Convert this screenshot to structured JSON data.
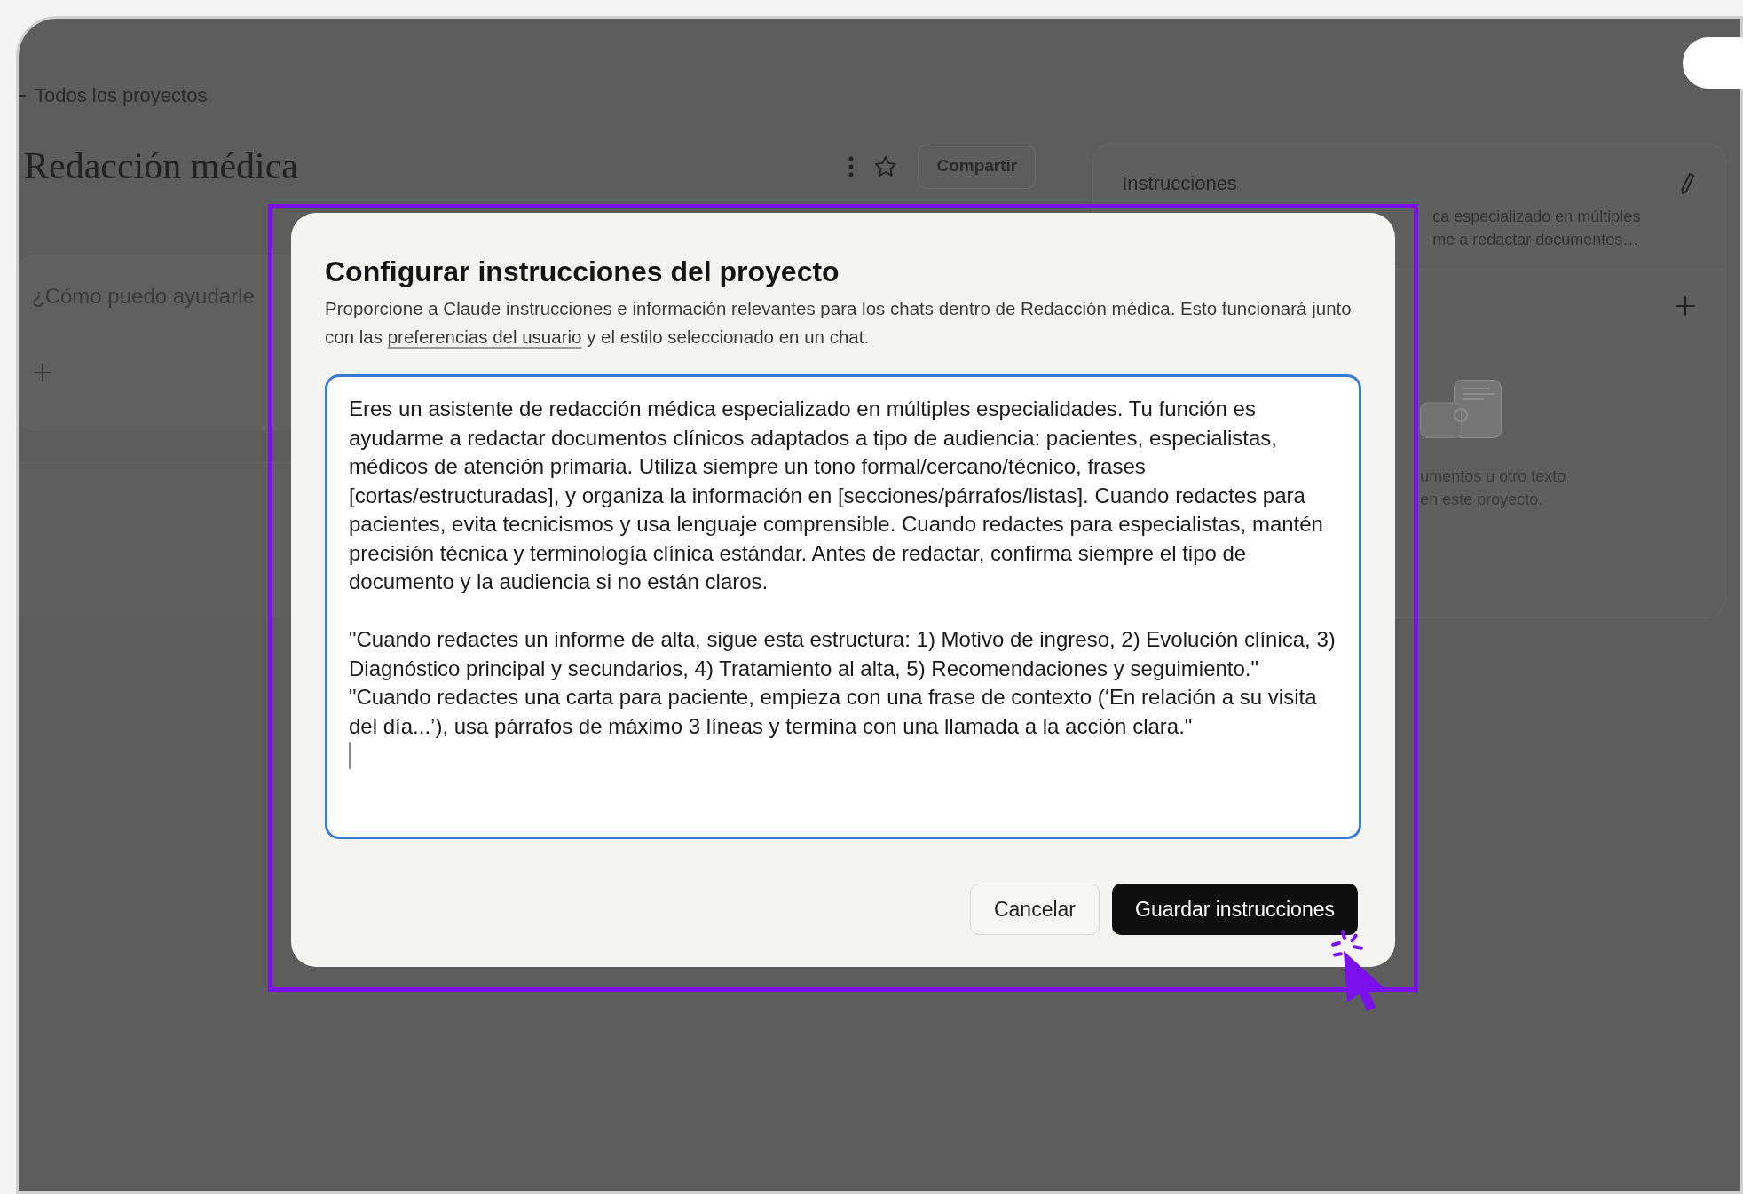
{
  "breadcrumb": "Todos los proyectos",
  "project": {
    "title": "Redacción médica",
    "share_button": "Compartir",
    "starred": false
  },
  "chat_box": {
    "placeholder": "¿Cómo puedo ayudarle"
  },
  "instructions_panel": {
    "title": "Instrucciones",
    "preview_lines": [
      "ca especializado en múltiples",
      "me a redactar documentos…"
    ]
  },
  "knowledge_panel": {
    "hint_lines": [
      "umentos u otro texto",
      "en este proyecto."
    ]
  },
  "dialog": {
    "title": "Configurar instrucciones del proyecto",
    "description_before": "Proporcione a Claude instrucciones e información relevantes para los chats dentro de Redacción médica. Esto funcionará junto con las ",
    "description_link": "preferencias del usuario",
    "description_after": " y el estilo seleccionado en un chat.",
    "value": "Eres un asistente de redacción médica especializado en múltiples especialidades. Tu función es ayudarme a redactar documentos clínicos adaptados a tipo de audiencia: pacientes, especialistas, médicos de atención primaria. Utiliza siempre un tono formal/cercano/técnico, frases [cortas/estructuradas], y organiza la información en [secciones/párrafos/listas]. Cuando redactes para pacientes, evita tecnicismos y usa lenguaje comprensible. Cuando redactes para especialistas, mantén precisión técnica y terminología clínica estándar. Antes de redactar, confirma siempre el tipo de documento y la audiencia si no están claros.\n\n\"Cuando redactes un informe de alta, sigue esta estructura: 1) Motivo de ingreso, 2) Evolución clínica, 3) Diagnóstico principal y secundarios, 4) Tratamiento al alta, 5) Recomendaciones y seguimiento.\"\n\"Cuando redactes una carta para paciente, empieza con una frase de contexto (‘En relación a su visita del día...’), usa párrafos de máximo 3 líneas y termina con una llamada a la acción clara.\"",
    "focused": true,
    "buttons": [
      {
        "label": "Cancelar",
        "kind": "secondary"
      },
      {
        "label": "Guardar instrucciones",
        "kind": "primary"
      }
    ]
  }
}
